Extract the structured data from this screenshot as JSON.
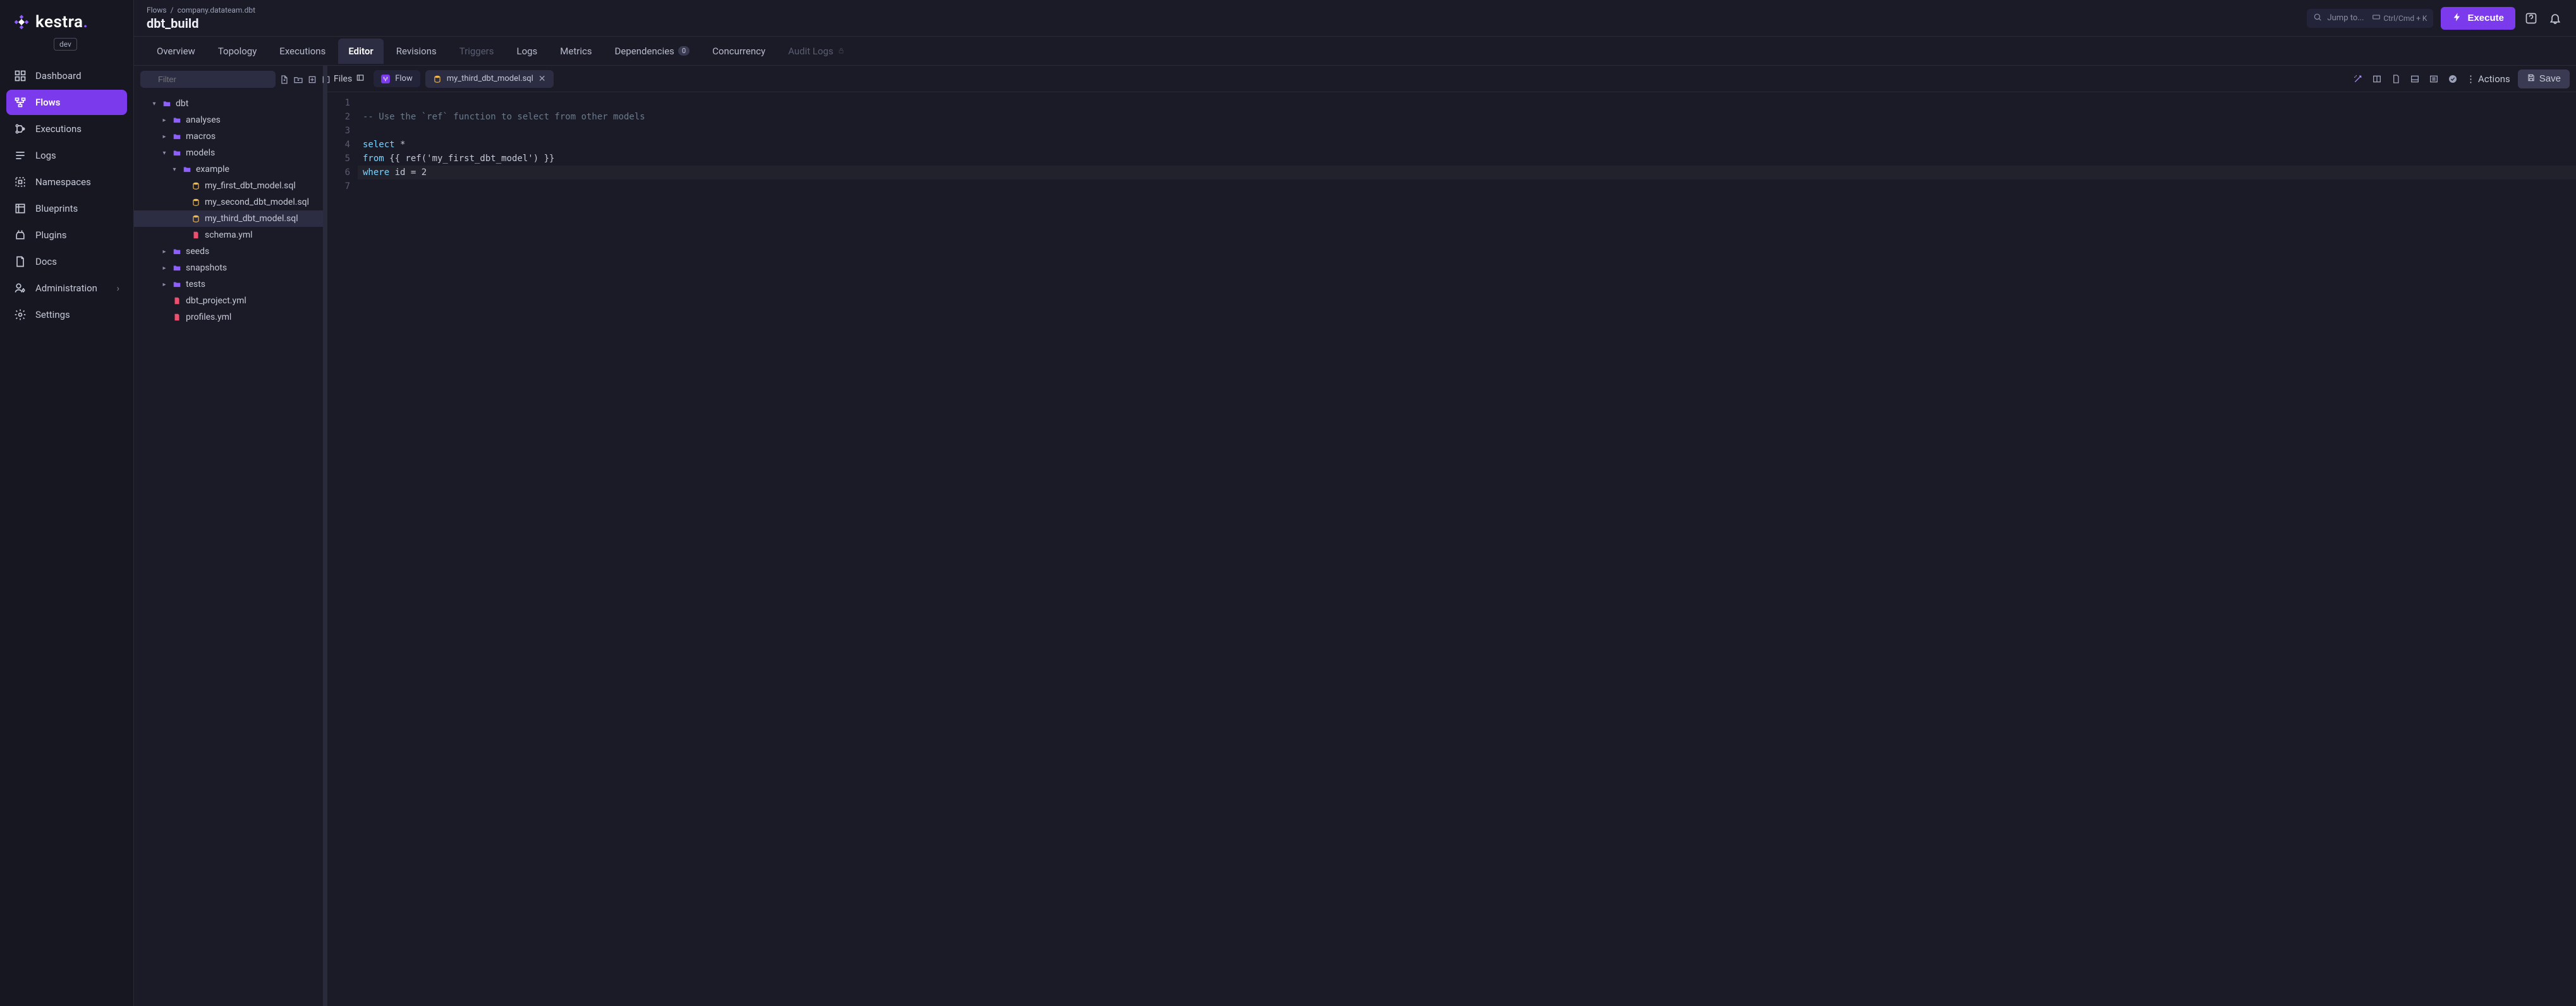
{
  "env_badge": "dev",
  "logo_text": "kestra",
  "nav": [
    {
      "label": "Dashboard",
      "icon": "dashboard-icon"
    },
    {
      "label": "Flows",
      "icon": "flows-icon",
      "active": true
    },
    {
      "label": "Executions",
      "icon": "executions-icon"
    },
    {
      "label": "Logs",
      "icon": "logs-icon"
    },
    {
      "label": "Namespaces",
      "icon": "namespaces-icon"
    },
    {
      "label": "Blueprints",
      "icon": "blueprints-icon"
    },
    {
      "label": "Plugins",
      "icon": "plugins-icon"
    },
    {
      "label": "Docs",
      "icon": "docs-icon"
    },
    {
      "label": "Administration",
      "icon": "administration-icon",
      "chevron": true
    },
    {
      "label": "Settings",
      "icon": "settings-icon"
    }
  ],
  "breadcrumb": {
    "root": "Flows",
    "sep": "/",
    "namespace": "company.datateam.dbt"
  },
  "page_title": "dbt_build",
  "search": {
    "placeholder": "Jump to...",
    "shortcut": "Ctrl/Cmd + K"
  },
  "execute_label": "Execute",
  "tabs": [
    {
      "label": "Overview"
    },
    {
      "label": "Topology"
    },
    {
      "label": "Executions"
    },
    {
      "label": "Editor",
      "active": true
    },
    {
      "label": "Revisions"
    },
    {
      "label": "Triggers",
      "disabled": true
    },
    {
      "label": "Logs"
    },
    {
      "label": "Metrics"
    },
    {
      "label": "Dependencies",
      "badge": "0"
    },
    {
      "label": "Concurrency"
    },
    {
      "label": "Audit Logs",
      "disabled": true,
      "lock": true
    }
  ],
  "filter_placeholder": "Filter",
  "tree": {
    "root": "dbt",
    "folders": {
      "analyses": "analyses",
      "macros": "macros",
      "models": "models",
      "example": "example",
      "seeds": "seeds",
      "snapshots": "snapshots",
      "tests": "tests"
    },
    "files": {
      "f1": "my_first_dbt_model.sql",
      "f2": "my_second_dbt_model.sql",
      "f3": "my_third_dbt_model.sql",
      "schema": "schema.yml",
      "dbt_project": "dbt_project.yml",
      "profiles": "profiles.yml"
    }
  },
  "editor": {
    "files_label": "Files",
    "tabs": {
      "flow": "Flow",
      "file": "my_third_dbt_model.sql"
    },
    "actions_label": "Actions",
    "save_label": "Save"
  },
  "code": {
    "line_numbers": [
      "1",
      "2",
      "3",
      "4",
      "5",
      "6",
      "7"
    ],
    "l2_comment": "-- Use the `ref` function to select from other models",
    "l4_select": "select",
    "l4_star": " *",
    "l5_from": "from",
    "l5_expr": " {{ ref('my_first_dbt_model') }}",
    "l6_where": "where",
    "l6_rest": " id = 2"
  }
}
